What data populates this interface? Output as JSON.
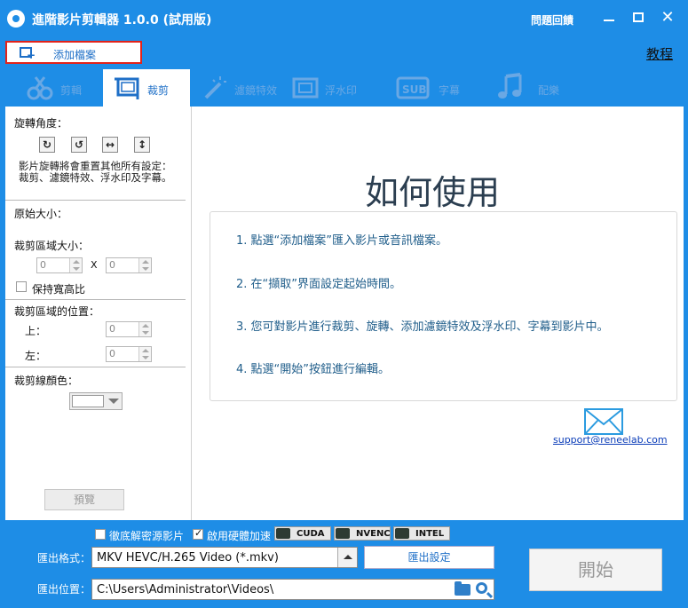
{
  "titlebar": {
    "title": "進階影片剪輯器 1.0.0 (試用版)",
    "feedback": "問題回饋"
  },
  "toolbar": {
    "add_file": "添加檔案",
    "tutorial": "教程"
  },
  "tabs": [
    {
      "label": "剪輯",
      "active": false
    },
    {
      "label": "裁剪",
      "active": true
    },
    {
      "label": "濾鏡特效",
      "active": false
    },
    {
      "label": "浮水印",
      "active": false
    },
    {
      "label": "字幕",
      "active": false
    },
    {
      "label": "配樂",
      "active": false
    }
  ],
  "sidebar": {
    "rotation_label": "旋轉角度：",
    "rotation_note": "影片旋轉將會重置其他所有設定：裁剪、濾鏡特效、浮水印及字幕。",
    "original_size_label": "原始大小：",
    "crop_size_label": "裁剪區域大小：",
    "width_value": "0",
    "x_sep": "X",
    "height_value": "0",
    "keep_ratio_label": "保持寬高比",
    "crop_position_label": "裁剪區域的位置：",
    "top_label": "上：",
    "top_value": "0",
    "left_label": "左：",
    "left_value": "0",
    "crop_line_color_label": "裁剪線顏色：",
    "crop_line_color": "#ffffff",
    "preview_button": "預覽"
  },
  "content": {
    "title": "如何使用",
    "steps": [
      "1. 點選“添加檔案”匯入影片或音訊檔案。",
      "2. 在“擷取”界面設定起始時間。",
      "3. 您可對影片進行裁剪、旋轉、添加濾鏡特效及浮水印、字幕到影片中。",
      "4. 點選“開始”按鈕進行編輯。"
    ],
    "support_email": "support@reneelab.com"
  },
  "bottom": {
    "decode_label": "徹底解密源影片",
    "hw_accel_label": "啟用硬體加速",
    "hw_badges": [
      "CUDA",
      "NVENC",
      "INTEL"
    ],
    "format_label": "匯出格式：",
    "format_value": "MKV HEVC/H.265 Video (*.mkv)",
    "output_settings": "匯出設定",
    "location_label": "匯出位置：",
    "location_value": "C:\\Users\\Administrator\\Videos\\",
    "start_button": "開始"
  },
  "colors": {
    "brand_blue": "#1e8de6",
    "highlight_red": "#e2231a"
  }
}
